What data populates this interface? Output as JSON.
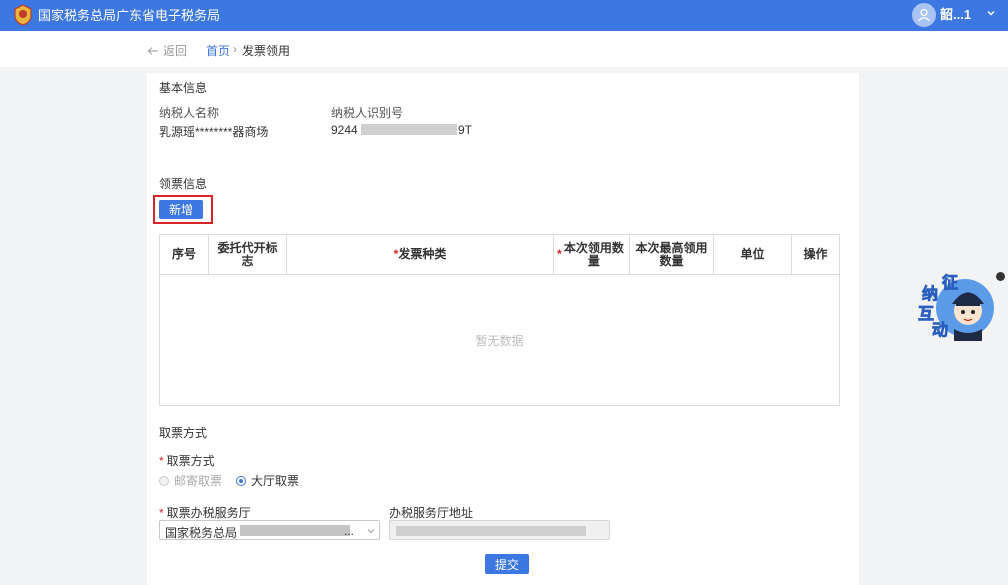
{
  "header": {
    "site_title": "国家税务总局广东省电子税务局",
    "user_name": "韶...1",
    "emblem_text": "税"
  },
  "breadcrumb": {
    "back_label": "返回",
    "home_label": "首页",
    "separator": "›",
    "current_label": "发票领用"
  },
  "basic_info": {
    "title": "基本信息",
    "taxpayer_name_label": "纳税人名称",
    "taxpayer_name_value": "乳源瑶********器商场",
    "taxpayer_id_label": "纳税人识别号",
    "taxpayer_id_prefix": "9244",
    "taxpayer_id_suffix": "9T"
  },
  "claim_info": {
    "title": "领票信息",
    "add_button": "新增",
    "table": {
      "columns": [
        {
          "label": "序号",
          "required": false
        },
        {
          "label": "委托代开标志",
          "required": false
        },
        {
          "label": "发票种类",
          "required": true
        },
        {
          "label": "本次领用数量",
          "required": true
        },
        {
          "label": "本次最高领用数量",
          "required": false
        },
        {
          "label": "单位",
          "required": false
        },
        {
          "label": "操作",
          "required": false
        }
      ],
      "empty_text": "暂无数据"
    }
  },
  "pickup": {
    "title": "取票方式",
    "method_label": "取票方式",
    "options": [
      {
        "label": "邮寄取票",
        "checked": false,
        "disabled": true
      },
      {
        "label": "大厅取票",
        "checked": true,
        "disabled": false
      }
    ],
    "hall_label": "取票办税服务厅",
    "hall_value": "国家税务总局",
    "hall_ellipsis": "...",
    "address_label": "办税服务厅地址"
  },
  "submit_button": "提交",
  "helper": {
    "chars": [
      "征",
      "纳",
      "互",
      "动"
    ]
  },
  "colors": {
    "brand_blue": "#3d77e2",
    "required_red": "#d9232b",
    "highlight_frame": "#d9232b"
  },
  "icons": [
    "emblem-icon",
    "user-avatar-icon",
    "chevron-down-icon",
    "back-arrow-icon",
    "select-caret-icon",
    "radio-icon",
    "helper-mascot-icon"
  ]
}
